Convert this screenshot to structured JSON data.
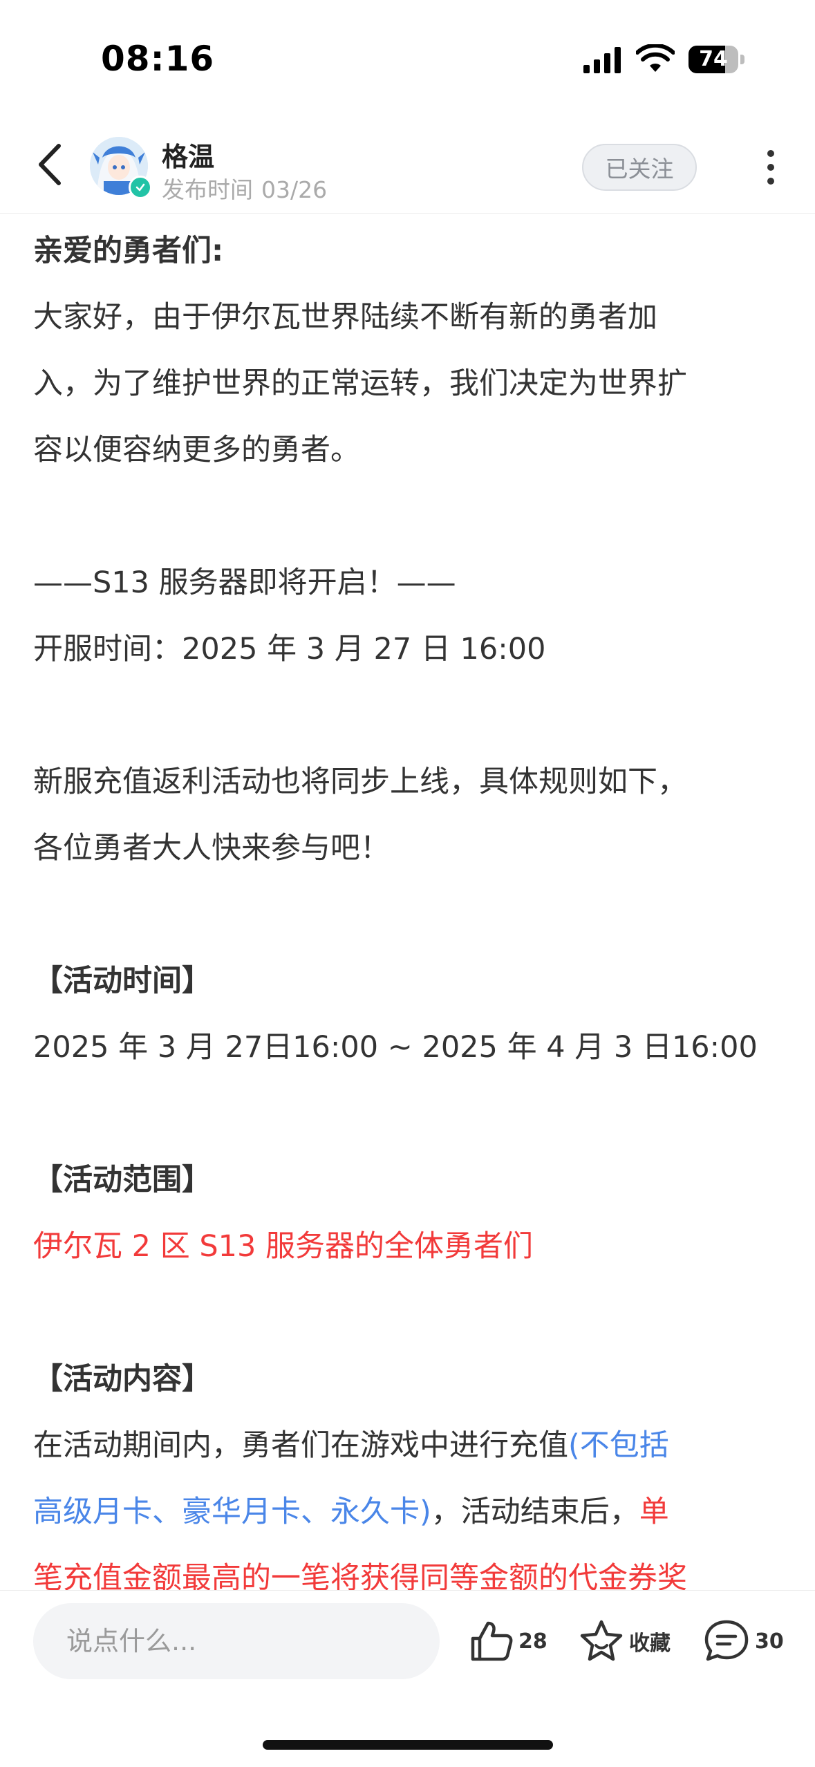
{
  "status_bar": {
    "time": "08:16",
    "battery": "74",
    "battery_level": 0.74
  },
  "header": {
    "author_name": "格温",
    "publish_label": "发布时间",
    "publish_date": "03/26",
    "follow_label": "已关注"
  },
  "article": {
    "greeting": "亲爱的勇者们:",
    "intro_1": "大家好，由于伊尔瓦世界陆续不断有新的勇者加",
    "intro_2": "入，为了维护世界的正常运转，我们决定为世界扩",
    "intro_3": "容以便容纳更多的勇者。",
    "server_heading": "——S13 服务器即将开启！——",
    "open_time": "开服时间：2025 年 3 月 27 日 16:00",
    "promo_1": "新服充值返利活动也将同步上线，具体规则如下，",
    "promo_2": "各位勇者大人快来参与吧！",
    "time_heading": "【活动时间】",
    "time_value": "2025 年 3 月 27日16:00 ~ 2025 年 4 月 3 日16:00",
    "scope_heading": "【活动范围】",
    "scope_value": "伊尔瓦 2 区 S13 服务器的全体勇者们",
    "content_heading": "【活动内容】",
    "content_1a": "在活动期间内，勇者们在游戏中进行充值",
    "content_1b": "(不包括",
    "content_2a": "高级月卡、豪华月卡、永久卡)",
    "content_2b": "，活动结束后，",
    "content_2c": "单",
    "content_3": "笔充值金额最高的一笔将获得同等金额的代金券奖"
  },
  "bottom_bar": {
    "comment_placeholder": "说点什么...",
    "like_count": "28",
    "favorite_label": "收藏",
    "comment_count": "30"
  },
  "colors": {
    "highlight_red": "#f23a3a",
    "highlight_blue": "#4a86e8",
    "verify_green": "#22c3a6"
  }
}
